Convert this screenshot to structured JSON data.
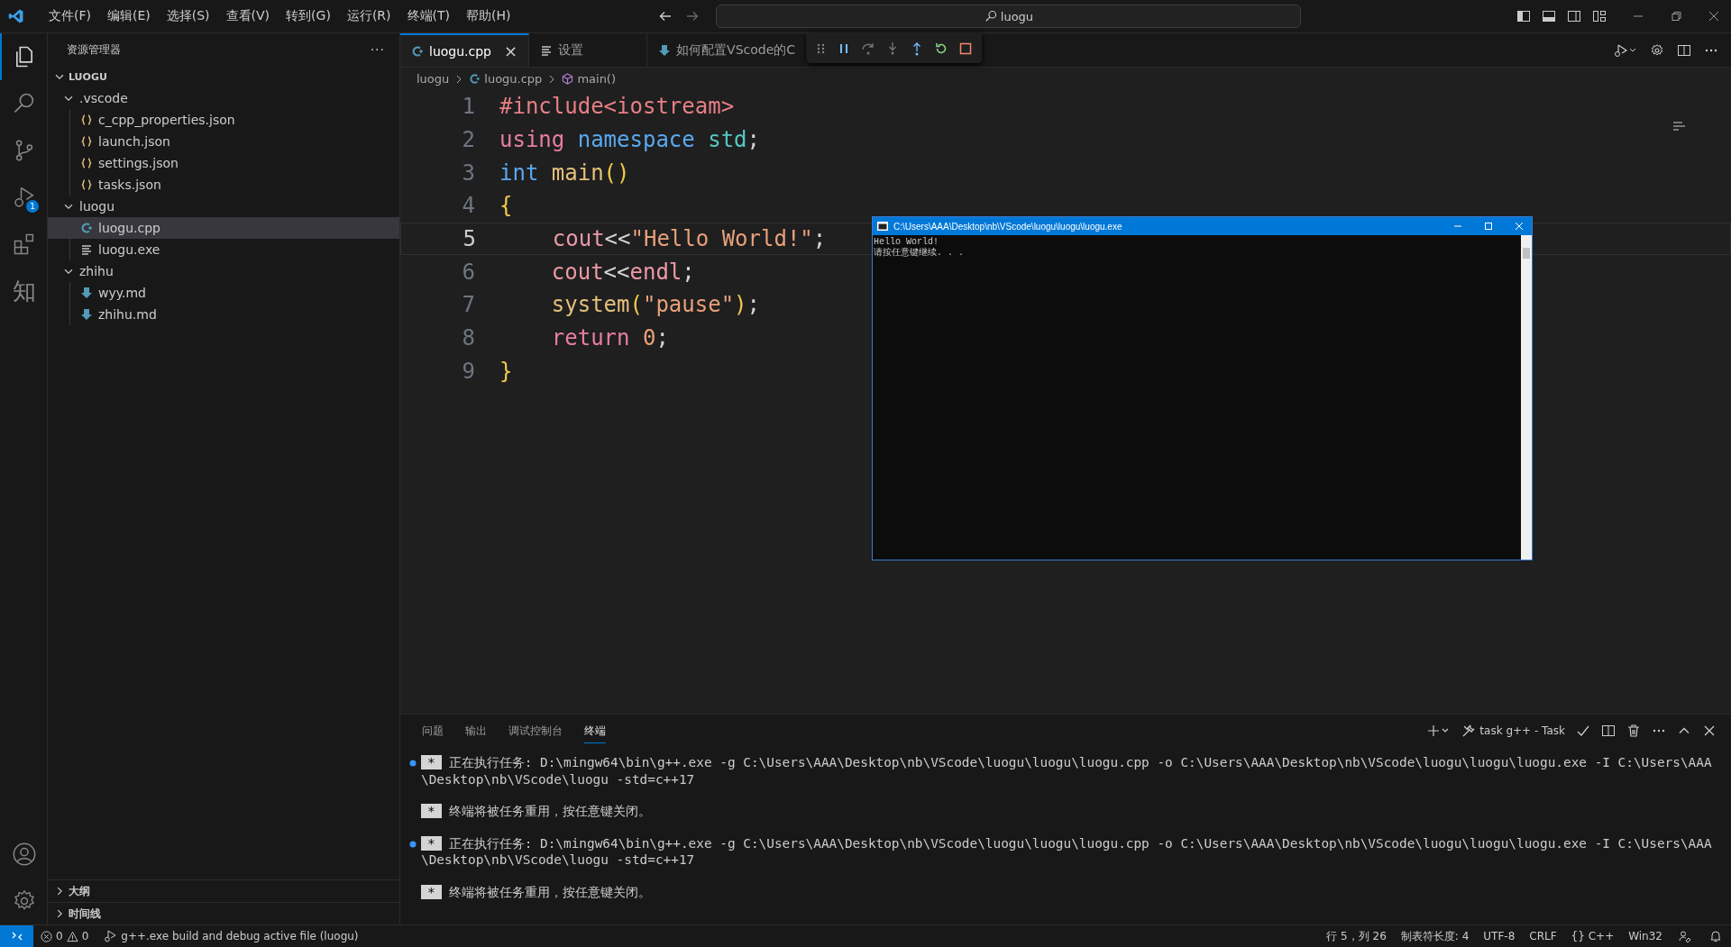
{
  "title_bar": {
    "menus": [
      "文件(F)",
      "编辑(E)",
      "选择(S)",
      "查看(V)",
      "转到(G)",
      "运行(R)",
      "终端(T)",
      "帮助(H)"
    ],
    "search": {
      "value": "luogu"
    }
  },
  "activity_bar": {
    "items": [
      {
        "kind": "explorer",
        "selected": true
      },
      {
        "kind": "search",
        "selected": false
      },
      {
        "kind": "source-control",
        "selected": false
      },
      {
        "kind": "run-debug",
        "selected": false,
        "badge": "1"
      },
      {
        "kind": "extensions",
        "selected": false
      },
      {
        "kind": "glyph",
        "selected": false,
        "text": "知"
      }
    ],
    "bottom": [
      {
        "kind": "account"
      },
      {
        "kind": "settings"
      }
    ]
  },
  "sidebar": {
    "title": "资源管理器",
    "more": "···",
    "root": {
      "label": "LUOGU",
      "expanded": true
    },
    "tree": [
      {
        "label": ".vscode",
        "kind": "folder",
        "expanded": true,
        "selected": false,
        "children": [
          {
            "label": "c_cpp_properties.json",
            "kind": "json",
            "selected": false
          },
          {
            "label": "launch.json",
            "kind": "json",
            "selected": false
          },
          {
            "label": "settings.json",
            "kind": "json",
            "selected": false
          },
          {
            "label": "tasks.json",
            "kind": "json",
            "selected": false
          }
        ]
      },
      {
        "label": "luogu",
        "kind": "folder",
        "expanded": true,
        "selected": false,
        "children": [
          {
            "label": "luogu.cpp",
            "kind": "cpp",
            "selected": true
          },
          {
            "label": "luogu.exe",
            "kind": "exe",
            "selected": false
          }
        ]
      },
      {
        "label": "zhihu",
        "kind": "folder",
        "expanded": true,
        "selected": false,
        "children": [
          {
            "label": "wyy.md",
            "kind": "md",
            "selected": false
          },
          {
            "label": "zhihu.md",
            "kind": "md",
            "selected": false
          }
        ]
      }
    ],
    "sections": [
      {
        "label": "大纲",
        "expanded": false
      },
      {
        "label": "时间线",
        "expanded": false
      }
    ]
  },
  "tabs": [
    {
      "label": "luogu.cpp",
      "kind": "cpp",
      "selected": true,
      "close": "×"
    },
    {
      "label": "设置",
      "kind": "settings",
      "selected": false
    },
    {
      "label": "如何配置VScode的C",
      "kind": "md",
      "selected": false
    }
  ],
  "breadcrumb": [
    {
      "label": "luogu",
      "kind": "folder"
    },
    {
      "label": "luogu.cpp",
      "kind": "cpp"
    },
    {
      "label": "main()",
      "kind": "symbol"
    }
  ],
  "code": [
    {
      "number": "1",
      "active": false,
      "tokens": [
        {
          "text": "#include<iostream>",
          "kind": "preproc"
        }
      ]
    },
    {
      "number": "2",
      "active": false,
      "tokens": [
        {
          "text": "using ",
          "kind": "keyword"
        },
        {
          "text": "namespace ",
          "kind": "storage"
        },
        {
          "text": "std",
          "kind": "type"
        },
        {
          "text": ";",
          "kind": "plain"
        }
      ]
    },
    {
      "number": "3",
      "active": false,
      "tokens": [
        {
          "text": "int ",
          "kind": "storage"
        },
        {
          "text": "main",
          "kind": "func"
        },
        {
          "text": "()",
          "kind": "brace"
        }
      ]
    },
    {
      "number": "4",
      "active": false,
      "tokens": [
        {
          "text": "{",
          "kind": "brace"
        }
      ]
    },
    {
      "number": "5",
      "active": true,
      "tokens": [
        {
          "text": "    cout",
          "kind": "variable"
        },
        {
          "text": "<<",
          "kind": "plain"
        },
        {
          "text": "\"Hello World!\"",
          "kind": "string"
        },
        {
          "text": ";",
          "kind": "plain"
        }
      ]
    },
    {
      "number": "6",
      "active": false,
      "tokens": [
        {
          "text": "    cout",
          "kind": "variable"
        },
        {
          "text": "<<",
          "kind": "plain"
        },
        {
          "text": "endl",
          "kind": "variable"
        },
        {
          "text": ";",
          "kind": "plain"
        }
      ]
    },
    {
      "number": "7",
      "active": false,
      "tokens": [
        {
          "text": "    system",
          "kind": "func"
        },
        {
          "text": "(",
          "kind": "brace"
        },
        {
          "text": "\"pause\"",
          "kind": "string"
        },
        {
          "text": ")",
          "kind": "brace"
        },
        {
          "text": ";",
          "kind": "plain"
        }
      ]
    },
    {
      "number": "8",
      "active": false,
      "tokens": [
        {
          "text": "    return ",
          "kind": "keyword"
        },
        {
          "text": "0",
          "kind": "number"
        },
        {
          "text": ";",
          "kind": "plain"
        }
      ]
    },
    {
      "number": "9",
      "active": false,
      "tokens": [
        {
          "text": "}",
          "kind": "brace"
        }
      ]
    }
  ],
  "console_window": {
    "title": "C:\\Users\\AAA\\Desktop\\nb\\VScode\\luogu\\luogu\\luogu.exe",
    "lines": [
      "Hello World!",
      "请按任意键继续. . ."
    ]
  },
  "panel": {
    "tabs": [
      {
        "label": "问题",
        "selected": false
      },
      {
        "label": "输出",
        "selected": false
      },
      {
        "label": "调试控制台",
        "selected": false
      },
      {
        "label": "终端",
        "selected": true
      }
    ],
    "task": "task g++ - Task",
    "terminal": [
      {
        "kind": "task",
        "badge": "*",
        "text": "正在执行任务: D:\\mingw64\\bin\\g++.exe -g C:\\Users\\AAA\\Desktop\\nb\\VScode\\luogu\\luogu\\luogu.cpp -o C:\\Users\\AAA\\Desktop\\nb\\VScode\\luogu\\luogu\\luogu.exe -I C:\\Users\\AAA\\Desktop\\nb\\VScode\\luogu -std=c++17"
      },
      {
        "kind": "notice",
        "badge": "*",
        "text": "终端将被任务重用，按任意键关闭。"
      },
      {
        "kind": "task",
        "badge": "*",
        "text": "正在执行任务: D:\\mingw64\\bin\\g++.exe -g C:\\Users\\AAA\\Desktop\\nb\\VScode\\luogu\\luogu\\luogu.cpp -o C:\\Users\\AAA\\Desktop\\nb\\VScode\\luogu\\luogu\\luogu.exe -I C:\\Users\\AAA\\Desktop\\nb\\VScode\\luogu -std=c++17"
      },
      {
        "kind": "notice",
        "badge": "*",
        "text": "终端将被任务重用，按任意键关闭。"
      }
    ]
  },
  "status_bar": {
    "errors": "0",
    "warnings": "0",
    "launch": "g++.exe build and debug active file (luogu)",
    "right": [
      "行 5，列 26",
      "制表符长度: 4",
      "UTF-8",
      "CRLF",
      "{} C++",
      "Win32"
    ]
  }
}
